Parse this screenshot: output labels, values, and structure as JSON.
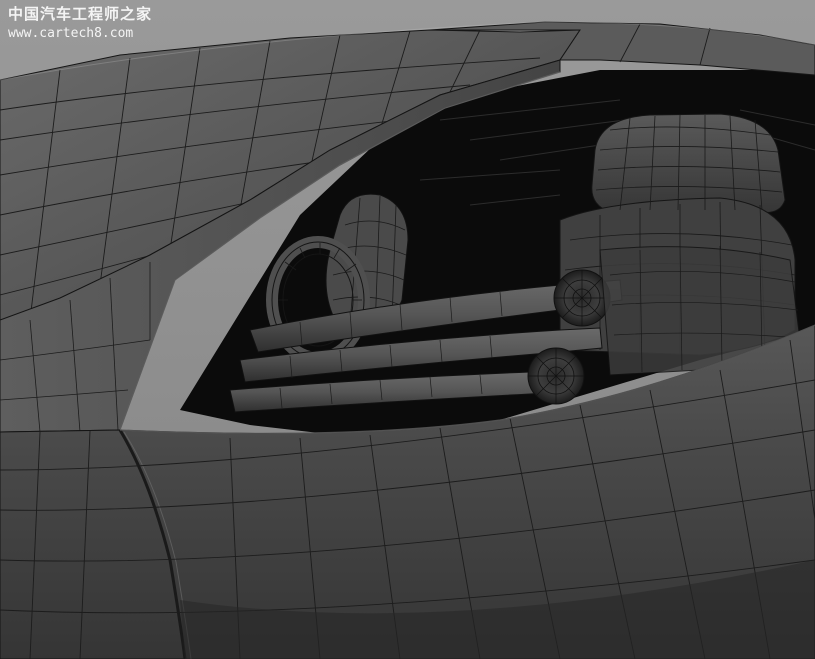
{
  "watermark": {
    "title": "中国汽车工程师之家",
    "url": "www.cartech8.com"
  },
  "colors": {
    "background": "#8f8f8f",
    "body_surface": "#4a4a4a",
    "body_dark": "#2a2a2a",
    "interior": "#0c0c0c",
    "wire": "#141414",
    "watermark_text": "#f4f4f4"
  }
}
